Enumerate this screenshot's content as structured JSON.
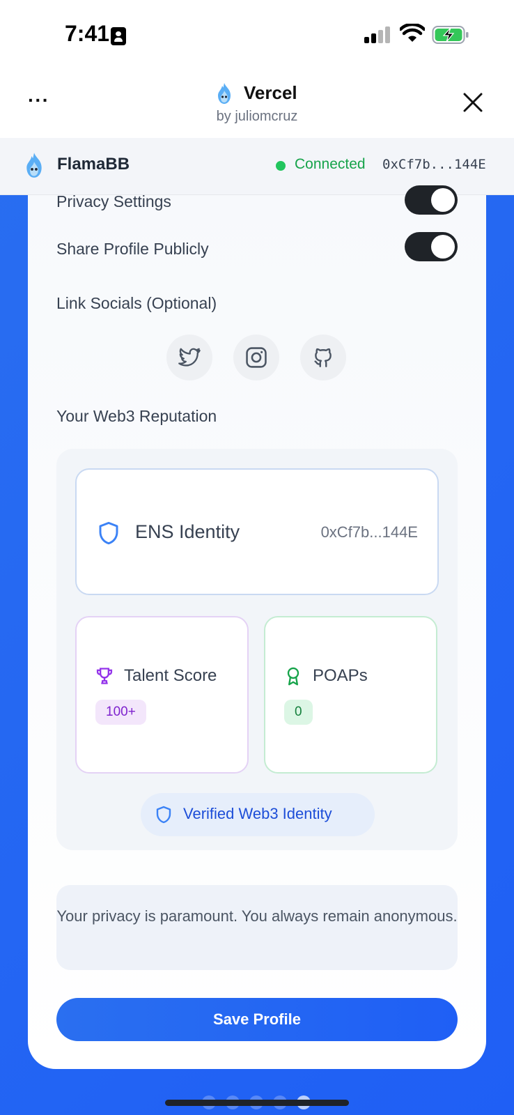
{
  "status_bar": {
    "time": "7:41"
  },
  "header": {
    "app_title": "Vercel",
    "app_subtitle": "by juliomcruz",
    "menu_label": "···"
  },
  "wallet": {
    "name": "FlamaBB",
    "status": "Connected",
    "address": "0xCf7b...144E"
  },
  "settings": {
    "privacy_label": "Privacy Settings",
    "privacy_enabled": true,
    "share_label": "Share Profile Publicly",
    "share_enabled": true,
    "socials_label": "Link Socials (Optional)",
    "socials": [
      "twitter-icon",
      "instagram-icon",
      "github-icon"
    ]
  },
  "reputation": {
    "title": "Your Web3 Reputation",
    "ens_label": "ENS Identity",
    "ens_address": "0xCf7b...144E",
    "talent_label": "Talent Score",
    "talent_value": "100+",
    "poaps_label": "POAPs",
    "poaps_value": "0",
    "verified_label": "Verified Web3 Identity"
  },
  "privacy_note": "Your privacy is paramount. You always remain anonymous.",
  "save_label": "Save Profile",
  "colors": {
    "accent": "#1f5ff5",
    "connected": "#22c55e",
    "talent": "#7e22ce",
    "poaps": "#15803d"
  }
}
